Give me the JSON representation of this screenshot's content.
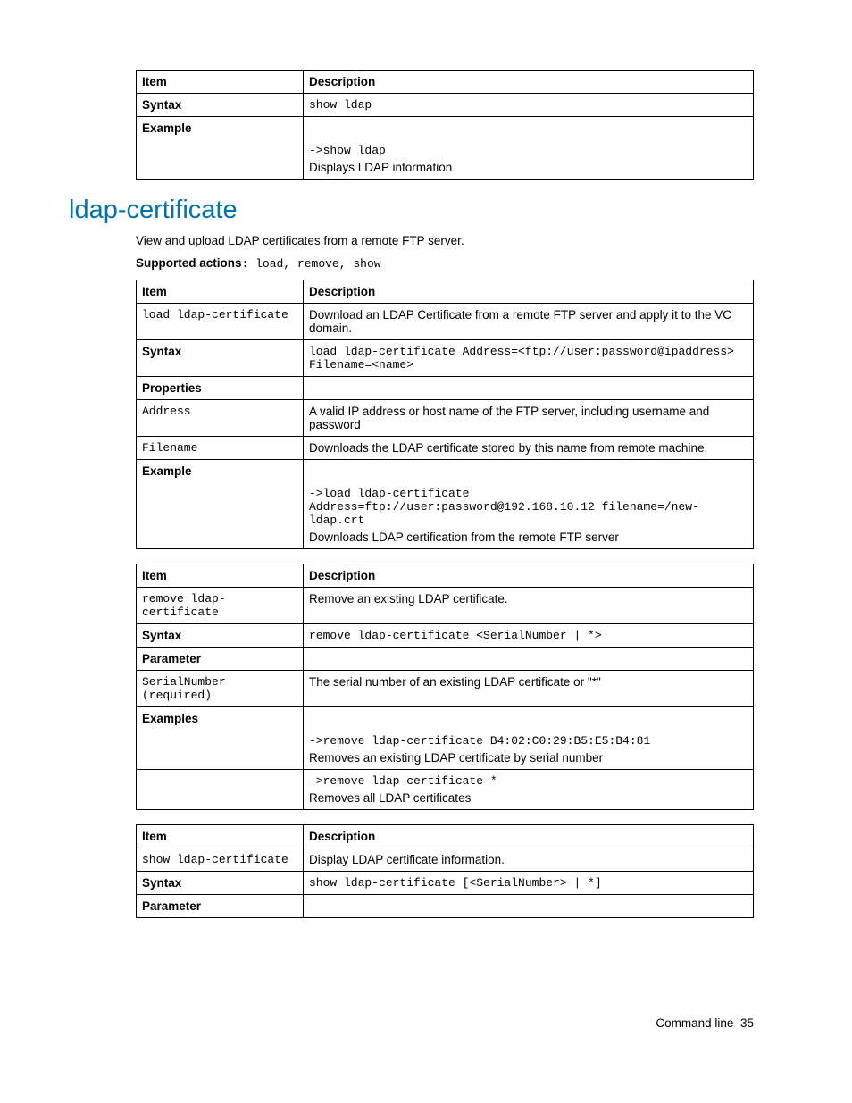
{
  "table1": {
    "headers": [
      "Item",
      "Description"
    ],
    "rows": {
      "syntax_label": "Syntax",
      "syntax_val": "show ldap",
      "example_label": "Example",
      "example_code": "->show ldap",
      "example_desc": "Displays LDAP information"
    }
  },
  "heading": "ldap-certificate",
  "intro": "View and upload LDAP certificates from a remote FTP server.",
  "supported_label": "Supported actions",
  "supported_actions": ": load, remove, show",
  "table2": {
    "headers": [
      "Item",
      "Description"
    ],
    "cmd": "load ldap-certificate",
    "cmd_desc": "Download an LDAP Certificate from a remote FTP server and apply it to the VC domain.",
    "syntax_label": "Syntax",
    "syntax_code": "load ldap-certificate Address=<ftp://user:password@ipaddress> Filename=<name>",
    "props_label": "Properties",
    "addr": "Address",
    "addr_desc": "A valid IP address or host name of the FTP server, including username and password",
    "fn": "Filename",
    "fn_desc": "Downloads the LDAP certificate stored by this name from remote machine.",
    "example_label": "Example",
    "example_code": "->load ldap-certificate Address=ftp://user:password@192.168.10.12 filename=/new-ldap.crt",
    "example_desc": "Downloads LDAP certification from the remote FTP server"
  },
  "table3": {
    "headers": [
      "Item",
      "Description"
    ],
    "cmd": "remove ldap-certificate",
    "cmd_desc": "Remove an existing LDAP certificate.",
    "syntax_label": "Syntax",
    "syntax_code": "remove ldap-certificate <SerialNumber | *>",
    "param_label": "Parameter",
    "sn": "SerialNumber (required)",
    "sn_desc": "The serial number of an existing LDAP certificate or \"*\"",
    "examples_label": "Examples",
    "ex1_code": "->remove ldap-certificate B4:02:C0:29:B5:E5:B4:81",
    "ex1_desc": "Removes an existing LDAP certificate by serial number",
    "ex2_code": "->remove ldap-certificate *",
    "ex2_desc": "Removes all LDAP certificates"
  },
  "table4": {
    "headers": [
      "Item",
      "Description"
    ],
    "cmd": "show ldap-certificate",
    "cmd_desc": "Display LDAP certificate information.",
    "syntax_label": "Syntax",
    "syntax_code": "show ldap-certificate [<SerialNumber> | *]",
    "param_label": "Parameter"
  },
  "footer_text": "Command line",
  "footer_page": "35"
}
